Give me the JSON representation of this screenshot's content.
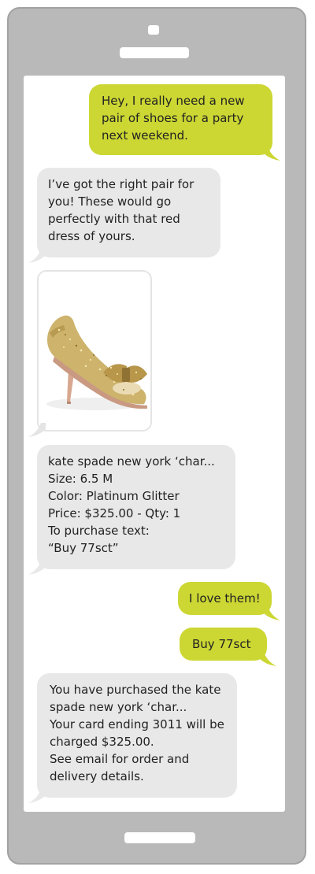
{
  "messages": {
    "m1": "Hey, I really need a new\npair of shoes for a party\nnext weekend.",
    "m2": "I’ve got the right pair for\nyou! These would go\nperfectly with that red\ndress of yours.",
    "m4": "kate spade new york ‘char...\nSize: 6.5 M\nColor: Platinum Glitter\nPrice: $325.00 - Qty: 1\nTo purchase text:\n“Buy 77sct”",
    "m5": "I love them!",
    "m6": "Buy 77sct",
    "m7": "You have purchased the kate\nspade new york ‘char...\nYour card ending 3011 will be\ncharged $325.00.\nSee email for order and\ndelivery details."
  },
  "product_image": "gold-glitter-bow-slingback-heel-photo",
  "colors": {
    "outgoing_bubble": "#ccd733",
    "incoming_bubble": "#e8e8e8",
    "phone_body": "#b9b9b9"
  }
}
